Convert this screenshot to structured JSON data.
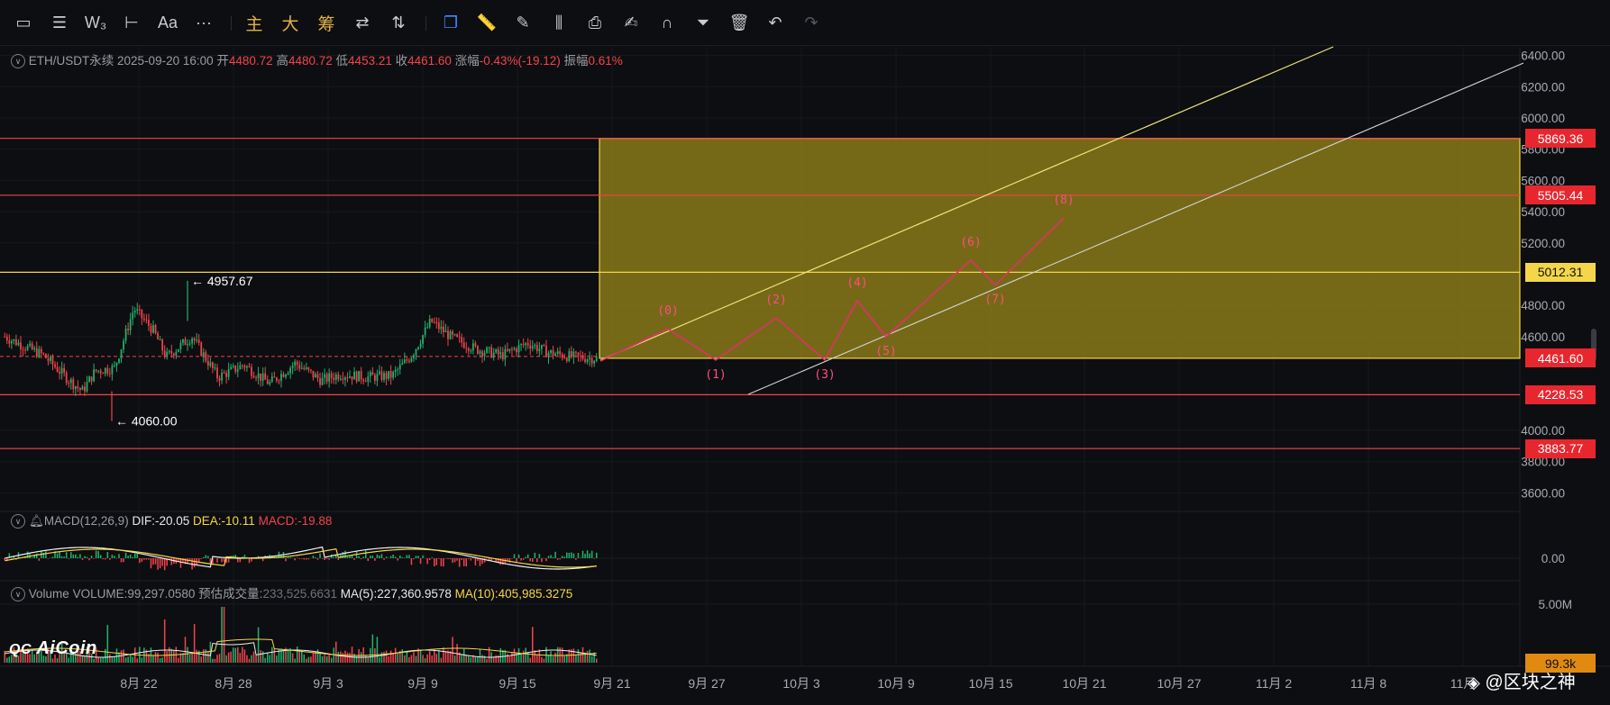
{
  "toolbar": {
    "items": [
      {
        "name": "rectangle-tool-icon",
        "glyph": "▭"
      },
      {
        "name": "horizontal-lines-icon",
        "glyph": "☰"
      },
      {
        "name": "wave-tool-icon",
        "glyph": "W₃"
      },
      {
        "name": "horizontal-ray-icon",
        "glyph": "⊢"
      },
      {
        "name": "text-tool-icon",
        "glyph": "Aa"
      },
      {
        "name": "more-icon",
        "glyph": "···"
      },
      {
        "name": "main-indicator-button",
        "glyph": "主"
      },
      {
        "name": "big-button",
        "glyph": "大"
      },
      {
        "name": "chips-button",
        "glyph": "筹"
      },
      {
        "name": "compare-icon",
        "glyph": "⇄"
      },
      {
        "name": "trade-icon",
        "glyph": "⇅"
      },
      {
        "name": "copy-icon",
        "glyph": "❐"
      },
      {
        "name": "ruler-icon",
        "glyph": "📏"
      },
      {
        "name": "pen-icon",
        "glyph": "✎"
      },
      {
        "name": "candles-icon",
        "glyph": "⫼"
      },
      {
        "name": "clipboard-icon",
        "glyph": "⎙"
      },
      {
        "name": "edit-icon",
        "glyph": "✍"
      },
      {
        "name": "magnet-icon",
        "glyph": "∩"
      },
      {
        "name": "filter-icon",
        "glyph": "⏷"
      },
      {
        "name": "delete-icon",
        "glyph": "🗑"
      },
      {
        "name": "undo-icon",
        "glyph": "↶"
      },
      {
        "name": "redo-icon",
        "glyph": "↷"
      }
    ]
  },
  "info": {
    "symbol": "ETH/USDT永续",
    "datetime": "2025-09-20 16:00",
    "open_label": "开",
    "open": "4480.72",
    "high_label": "高",
    "high": "4480.72",
    "low_label": "低",
    "low": "4453.21",
    "close_label": "收",
    "close": "4461.60",
    "change_label": "涨幅",
    "change": "-0.43%(-19.12)",
    "amp_label": "振幅",
    "amp": "0.61%"
  },
  "macd": {
    "title": "MACD(12,26,9)",
    "dif": "DIF:-20.05",
    "dea": "DEA:-10.11",
    "macd": "MACD:-19.88"
  },
  "volume": {
    "title": "Volume",
    "volume": "VOLUME:99,297.0580",
    "est_label": "预估成交量:",
    "est": "233,525.6631",
    "ma5": "MA(5):227,360.9578",
    "ma10": "MA(10):405,985.3275"
  },
  "watermark": {
    "logo": "AiCoin",
    "author": "@区块之神"
  },
  "colors": {
    "bg": "#0d0e11",
    "red": "#f2434a",
    "yellow": "#f4d64a",
    "pink": "#ff4d7d",
    "green": "#20b26c",
    "box": "#b3a21f"
  },
  "chart_data": {
    "type": "line",
    "symbol": "ETH/USDT永续",
    "y_axis_ticks": [
      "6400.00",
      "6200.00",
      "6000.00",
      "5800.00",
      "5600.00",
      "5400.00",
      "5200.00",
      "4800.00",
      "4600.00",
      "4000.00",
      "3800.00",
      "3600.00"
    ],
    "ylim": [
      3500,
      6450
    ],
    "x_axis_ticks": [
      "8月 22",
      "8月 28",
      "9月 3",
      "9月 9",
      "9月 15",
      "9月 21",
      "9月 27",
      "10月 3",
      "10月 9",
      "10月 15",
      "10月 21",
      "10月 27",
      "11月 2",
      "11月 8",
      "11月"
    ],
    "price_levels": [
      {
        "value": "5869.36",
        "color": "red"
      },
      {
        "value": "5505.44",
        "color": "red"
      },
      {
        "value": "5012.31",
        "color": "yellow"
      },
      {
        "value": "4461.60",
        "color": "red"
      },
      {
        "value": "4228.53",
        "color": "red"
      },
      {
        "value": "3883.77",
        "color": "red"
      }
    ],
    "annotations": {
      "high": "4957.67",
      "low": "4060.00"
    },
    "projection_box": {
      "from_price": 4461.6,
      "to_price": 5869.36
    },
    "wave_labels": [
      "(0)",
      "(1)",
      "(2)",
      "(3)",
      "(4)",
      "(5)",
      "(6)",
      "(7)",
      "(8)"
    ],
    "wave_path": [
      4650,
      4450,
      4720,
      4450,
      4830,
      4600,
      5090,
      4930,
      5360
    ],
    "macd_axis": "0.00",
    "volume_axis": "5.00M",
    "volume_tag": "99.3k"
  }
}
